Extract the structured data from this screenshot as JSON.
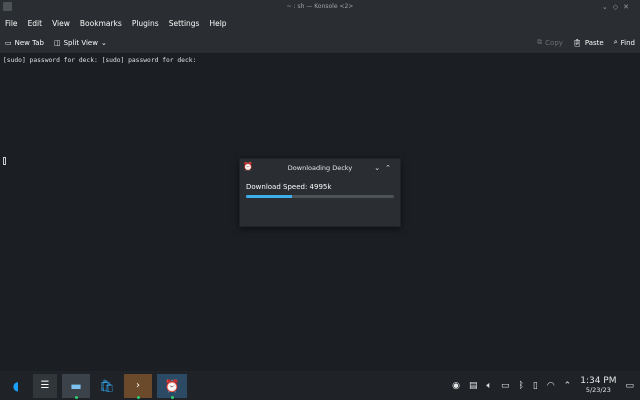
{
  "window": {
    "title": "~ : sh — Konsole <2>",
    "controls": [
      "⌄",
      "◇",
      "✕"
    ]
  },
  "menu": [
    "File",
    "Edit",
    "View",
    "Bookmarks",
    "Plugins",
    "Settings",
    "Help"
  ],
  "toolbar": {
    "new_tab": "New Tab",
    "split_view": "Split View",
    "copy": "Copy",
    "paste": "Paste",
    "find": "Find"
  },
  "terminal": {
    "output": "[sudo] password for deck: [sudo] password for deck:"
  },
  "dialog": {
    "title": "Downloading Decky",
    "label": "Download Speed: 4995k",
    "progress_percent": 31
  },
  "taskbar": {
    "time": "1:34 PM",
    "date": "5/23/23"
  }
}
